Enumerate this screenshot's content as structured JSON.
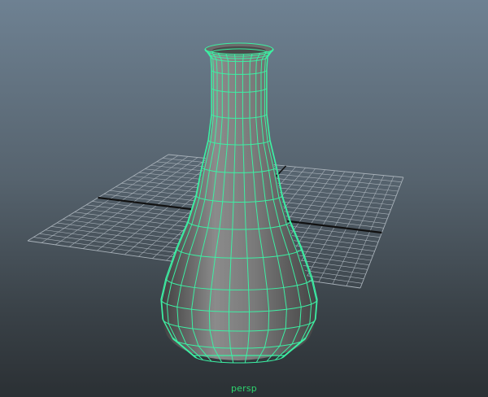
{
  "viewport": {
    "camera_label": "persp"
  },
  "colors": {
    "wireframe": "#3cf0a4",
    "grid_line": "#a9b2ba",
    "grid_axis": "#111111",
    "mesh_light": "#8a8a8a",
    "mesh_dark": "#454545"
  },
  "scene": {
    "object": "erlenmeyer-flask",
    "display_mode": "shaded-wireframe"
  }
}
